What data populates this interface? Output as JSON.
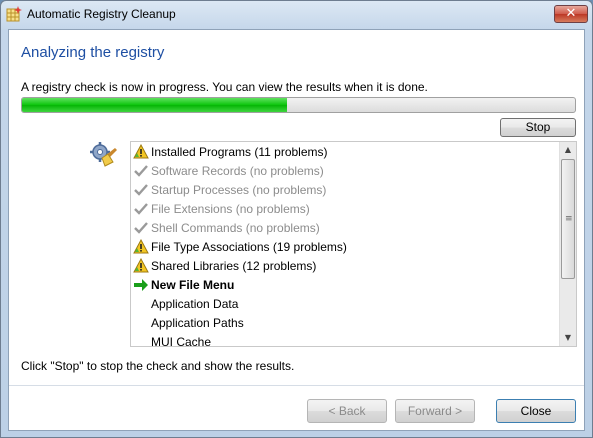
{
  "window": {
    "title": "Automatic Registry Cleanup",
    "close_glyph": "✕"
  },
  "main": {
    "heading": "Analyzing the registry",
    "intro": "A registry check is now in progress. You can view the results when it is done.",
    "progress_fraction": 0.48,
    "stop_label": "Stop",
    "footer_text": "Click \"Stop\" to stop the check and show the results."
  },
  "results": {
    "items": [
      {
        "label": "Installed Programs (11 problems)",
        "status": "warning"
      },
      {
        "label": "Software Records (no problems)",
        "status": "done"
      },
      {
        "label": "Startup Processes (no problems)",
        "status": "done"
      },
      {
        "label": "File Extensions (no problems)",
        "status": "done"
      },
      {
        "label": "Shell Commands (no problems)",
        "status": "done"
      },
      {
        "label": "File Type Associations (19 problems)",
        "status": "warning"
      },
      {
        "label": "Shared Libraries (12 problems)",
        "status": "warning"
      },
      {
        "label": "New File Menu",
        "status": "current"
      },
      {
        "label": "Application Data",
        "status": "pending"
      },
      {
        "label": "Application Paths",
        "status": "pending"
      },
      {
        "label": "MUI Cache",
        "status": "pending"
      }
    ]
  },
  "buttons": {
    "back": "< Back",
    "forward": "Forward >",
    "close": "Close"
  },
  "icons": {
    "app": "grid-sparkle-icon",
    "scanner": "gear-broom-icon",
    "warning": "warning-triangle-icon",
    "done": "check-icon",
    "current": "green-arrow-icon"
  },
  "colors": {
    "heading": "#1e4fa3",
    "progress": "#0cc50c",
    "warning": "#f3c623",
    "arrow": "#1a9e1a"
  }
}
